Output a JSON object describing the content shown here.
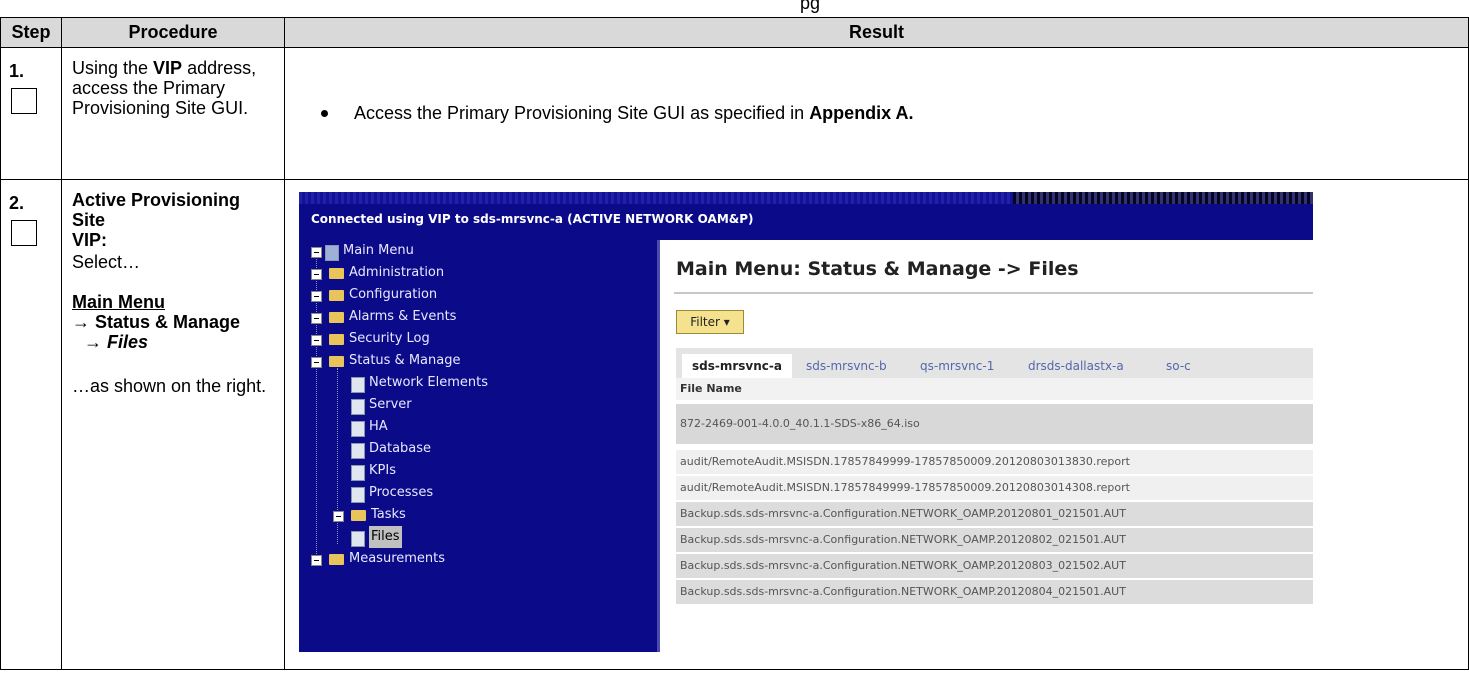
{
  "top_fragment": "pg",
  "table": {
    "headers": {
      "step": "Step",
      "procedure": "Procedure",
      "result": "Result"
    }
  },
  "rows": [
    {
      "step": "1.",
      "procedure": {
        "pre": "Using the ",
        "bold": "VIP",
        "post": " address,",
        "line2": "access the Primary",
        "line3": "Provisioning Site GUI."
      },
      "result": {
        "text": "Access the Primary Provisioning Site GUI as specified in ",
        "bold": "Appendix A."
      }
    },
    {
      "step": "2.",
      "procedure": {
        "heading1": "Active Provisioning Site",
        "heading2": "VIP:",
        "select": "Select…",
        "menu": "Main Menu",
        "sub1": "→ Status & Manage",
        "sub2_arrow": "→ ",
        "sub2": "Files",
        "shown": "…as shown on the right."
      }
    }
  ],
  "screenshot": {
    "connection": "Connected using VIP to sds-mrsvnc-a (ACTIVE NETWORK OAM&P)",
    "tree": [
      "Main Menu",
      "Administration",
      "Configuration",
      "Alarms & Events",
      "Security Log",
      "Status & Manage",
      "Network Elements",
      "Server",
      "HA",
      "Database",
      "KPIs",
      "Processes",
      "Tasks",
      "Files",
      "Measurements"
    ],
    "title": "Main Menu: Status & Manage -> Files",
    "filter": "Filter",
    "tabs": [
      "sds-mrsvnc-a",
      "sds-mrsvnc-b",
      "qs-mrsvnc-1",
      "drsds-dallastx-a",
      "so-c"
    ],
    "column": "File Name",
    "files": [
      "872-2469-001-4.0.0_40.1.1-SDS-x86_64.iso",
      "audit/RemoteAudit.MSISDN.17857849999-17857850009.20120803013830.report",
      "audit/RemoteAudit.MSISDN.17857849999-17857850009.20120803014308.report",
      "Backup.sds.sds-mrsvnc-a.Configuration.NETWORK_OAMP.20120801_021501.AUT",
      "Backup.sds.sds-mrsvnc-a.Configuration.NETWORK_OAMP.20120802_021501.AUT",
      "Backup.sds.sds-mrsvnc-a.Configuration.NETWORK_OAMP.20120803_021502.AUT",
      "Backup.sds.sds-mrsvnc-a.Configuration.NETWORK_OAMP.20120804_021501.AUT"
    ]
  }
}
